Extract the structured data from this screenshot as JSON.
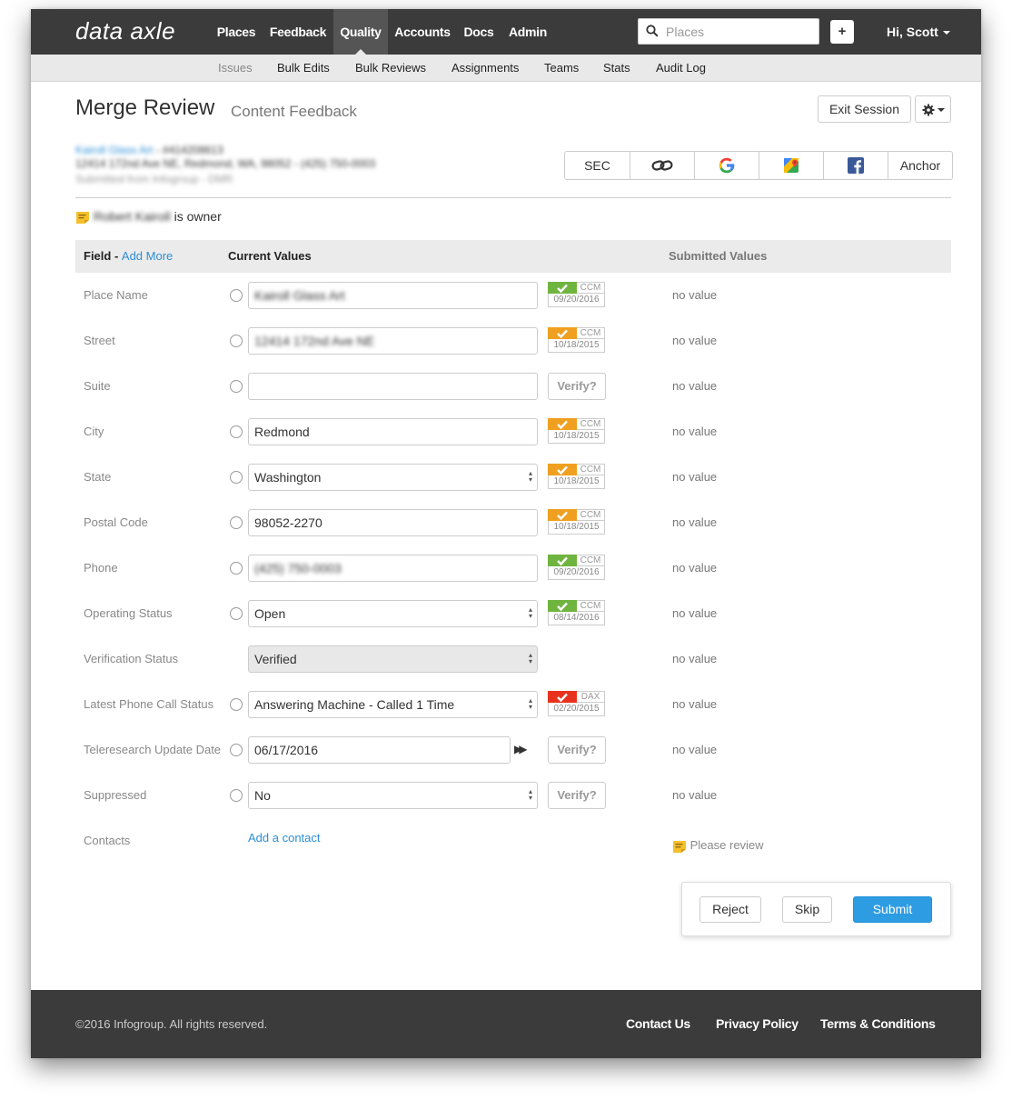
{
  "brand": "data axle",
  "nav": {
    "items": [
      {
        "label": "Places"
      },
      {
        "label": "Feedback"
      },
      {
        "label": "Quality",
        "active": true
      },
      {
        "label": "Accounts"
      },
      {
        "label": "Docs"
      },
      {
        "label": "Admin"
      }
    ],
    "search_placeholder": "Places",
    "plus_label": "+",
    "user_label": "Hi, Scott"
  },
  "subnav": {
    "items": [
      {
        "label": "Issues",
        "active": true
      },
      {
        "label": "Bulk Edits"
      },
      {
        "label": "Bulk Reviews"
      },
      {
        "label": "Assignments"
      },
      {
        "label": "Teams"
      },
      {
        "label": "Stats"
      },
      {
        "label": "Audit Log"
      }
    ]
  },
  "header": {
    "title": "Merge Review",
    "subtitle": "Content Feedback",
    "exit_label": "Exit Session"
  },
  "business": {
    "name": "Kairoll Glass Art",
    "id": "414208613",
    "address": "12414 172nd Ave NE, Redmond, WA, 98052 - (425) 750-0003",
    "source": "Submitted from Infogroup - DMR"
  },
  "links": {
    "sec": "SEC",
    "anchor": "Anchor"
  },
  "owner": {
    "name": "Robert Kairoll",
    "suffix": "is owner"
  },
  "table": {
    "field_header": "Field",
    "add_more": "Add More",
    "current_header": "Current Values",
    "submitted_header": "Submitted Values",
    "rows": [
      {
        "label": "Place Name",
        "value": "Kairoll Glass Art",
        "blurred": true,
        "badge": {
          "color": "#6fb43f",
          "source": "CCM",
          "date": "09/20/2016"
        },
        "submitted": "no value"
      },
      {
        "label": "Street",
        "value": "12414 172nd Ave NE",
        "blurred": true,
        "badge": {
          "color": "#f0a020",
          "source": "CCM",
          "date": "10/18/2015"
        },
        "submitted": "no value"
      },
      {
        "label": "Suite",
        "value": "",
        "verify": "Verify?",
        "submitted": "no value"
      },
      {
        "label": "City",
        "value": "Redmond",
        "badge": {
          "color": "#f0a020",
          "source": "CCM",
          "date": "10/18/2015"
        },
        "submitted": "no value"
      },
      {
        "label": "State",
        "value": "Washington",
        "select": true,
        "badge": {
          "color": "#f0a020",
          "source": "CCM",
          "date": "10/18/2015"
        },
        "submitted": "no value"
      },
      {
        "label": "Postal Code",
        "value": "98052-2270",
        "badge": {
          "color": "#f0a020",
          "source": "CCM",
          "date": "10/18/2015"
        },
        "submitted": "no value"
      },
      {
        "label": "Phone",
        "value": "(425) 750-0003",
        "blurred": true,
        "badge": {
          "color": "#6fb43f",
          "source": "CCM",
          "date": "09/20/2016"
        },
        "submitted": "no value"
      },
      {
        "label": "Operating Status",
        "value": "Open",
        "select": true,
        "badge": {
          "color": "#6fb43f",
          "source": "CCM",
          "date": "08/14/2016"
        },
        "submitted": "no value"
      },
      {
        "label": "Verification Status",
        "value": "Verified",
        "select": true,
        "disabled": true,
        "no_radio": true,
        "submitted": "no value"
      },
      {
        "label": "Latest Phone Call Status",
        "value": "Answering Machine - Called 1 Time",
        "select": true,
        "badge": {
          "color": "#e8321e",
          "source": "DAX",
          "date": "02/20/2015"
        },
        "submitted": "no value"
      },
      {
        "label": "Teleresearch Update Date",
        "value": "06/17/2016",
        "date": true,
        "verify": "Verify?",
        "submitted": "no value"
      },
      {
        "label": "Suppressed",
        "value": "No",
        "select": true,
        "verify": "Verify?",
        "submitted": "no value"
      }
    ],
    "contacts_label": "Contacts",
    "add_contact": "Add a contact",
    "review_note": "Please review"
  },
  "actions": {
    "reject": "Reject",
    "skip": "Skip",
    "submit": "Submit"
  },
  "footer": {
    "copyright": "©2016 Infogroup. All rights reserved.",
    "links": [
      "Contact Us",
      "Privacy Policy",
      "Terms & Conditions"
    ]
  }
}
